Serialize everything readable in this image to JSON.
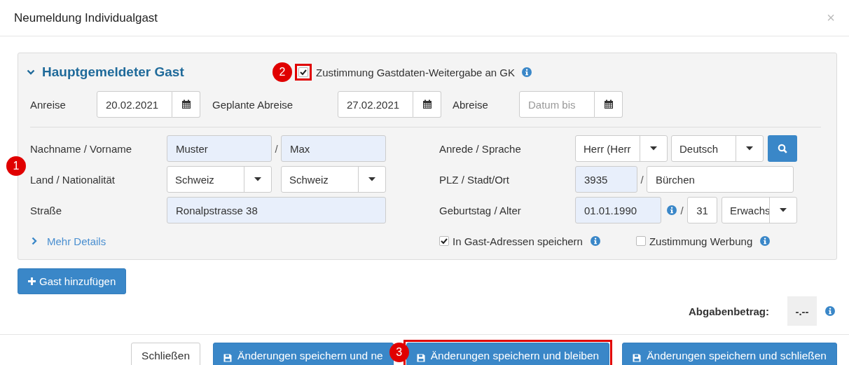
{
  "dialog": {
    "title": "Neumeldung Individualgast",
    "close": "×"
  },
  "guest_panel": {
    "expanded": true,
    "title": "Hauptgemeldeter Gast",
    "consent": {
      "label": "Zustimmung Gastdaten-Weitergabe an GK",
      "checked": true,
      "highlighted": true
    },
    "dates": [
      {
        "label": "Anreise",
        "value": "20.02.2021"
      },
      {
        "label": "Geplante Abreise",
        "value": "27.02.2021"
      },
      {
        "label": "Abreise",
        "placeholder": "Datum bis"
      }
    ],
    "name": {
      "label": "Nachname / Vorname",
      "last_name": {
        "value": "Muster",
        "prefilled": true
      },
      "separator": "/",
      "first_name": {
        "value": "Max",
        "prefilled": true
      }
    },
    "country": {
      "label": "Land / Nationalität",
      "country": "Schweiz",
      "nationality": "Schweiz"
    },
    "street": {
      "label": "Straße",
      "value": "Ronalpstrasse 38",
      "prefilled": true
    },
    "more_details": {
      "label": "Mehr Details",
      "expanded": false
    },
    "salutation": {
      "label": "Anrede / Sprache",
      "salutation": "Herr (Herr",
      "language": "Deutsch"
    },
    "postal": {
      "label": "PLZ / Stadt/Ort",
      "zip": {
        "value": "3935",
        "prefilled": true
      },
      "separator": "/",
      "city": {
        "value": "Bürchen",
        "prefilled": false
      }
    },
    "birth": {
      "label": "Geburtstag / Alter",
      "date": {
        "value": "01.01.1990",
        "prefilled": true
      },
      "separator": "/",
      "age": "31",
      "age_group": "Erwachs"
    },
    "options": [
      {
        "label": "In Gast-Adressen speichern",
        "checked": true
      },
      {
        "label": "Zustimmung Werbung",
        "checked": false
      }
    ]
  },
  "add_guest_button": "Gast hinzufügen",
  "fee": {
    "label": "Abgabenbetrag:",
    "value": "-.--"
  },
  "footer_buttons": [
    {
      "label": "Schließen",
      "kind": "default",
      "highlighted": false
    },
    {
      "label": "Änderungen speichern und ne",
      "kind": "save",
      "highlighted": false
    },
    {
      "label": "Änderungen speichern und bleiben",
      "kind": "save",
      "highlighted": true
    },
    {
      "label": "Änderungen speichern und schließen",
      "kind": "save",
      "highlighted": false
    }
  ],
  "annotations": [
    {
      "number": "1"
    },
    {
      "number": "2"
    },
    {
      "number": "3"
    }
  ]
}
